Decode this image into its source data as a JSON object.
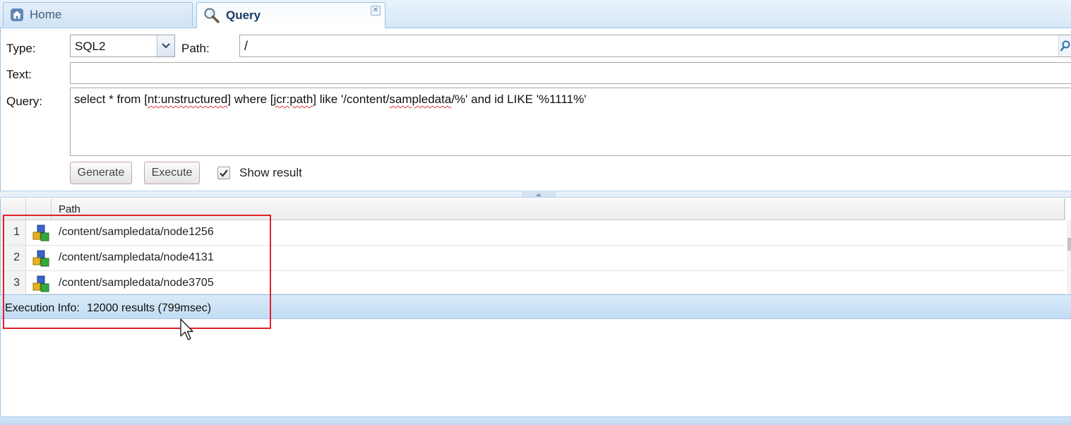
{
  "tabs": [
    {
      "label": "Home",
      "icon": "home-icon"
    },
    {
      "label": "Query",
      "icon": "magnifier-icon",
      "active": true,
      "closable": true
    }
  ],
  "form": {
    "type_label": "Type:",
    "type_value": "SQL2",
    "path_label": "Path:",
    "path_value": "/",
    "text_label": "Text:",
    "text_value": "",
    "query_label": "Query:",
    "query_segments": [
      {
        "text": "select * from [",
        "flag": false
      },
      {
        "text": "nt:unstructured",
        "flag": true
      },
      {
        "text": "] where [",
        "flag": false
      },
      {
        "text": "jcr:path",
        "flag": true
      },
      {
        "text": "] like '/content/",
        "flag": false
      },
      {
        "text": "sampledata",
        "flag": true
      },
      {
        "text": "/%' and id LIKE '%1111%'",
        "flag": false
      }
    ],
    "generate_label": "Generate",
    "execute_label": "Execute",
    "show_result_label": "Show result",
    "show_result_checked": true
  },
  "results": {
    "columns": [
      "",
      "",
      "Path"
    ],
    "rows": [
      {
        "num": "1",
        "path": "/content/sampledata/node1256"
      },
      {
        "num": "2",
        "path": "/content/sampledata/node4131"
      },
      {
        "num": "3",
        "path": "/content/sampledata/node3705"
      }
    ],
    "row_icon": "node-cubes-icon"
  },
  "execution": {
    "label": "Execution Info:",
    "value": "12000 results (799msec)"
  },
  "colors": {
    "highlight": "#e2202a",
    "accent": "#9fc3e6",
    "spellcheck": "#e0383e"
  }
}
